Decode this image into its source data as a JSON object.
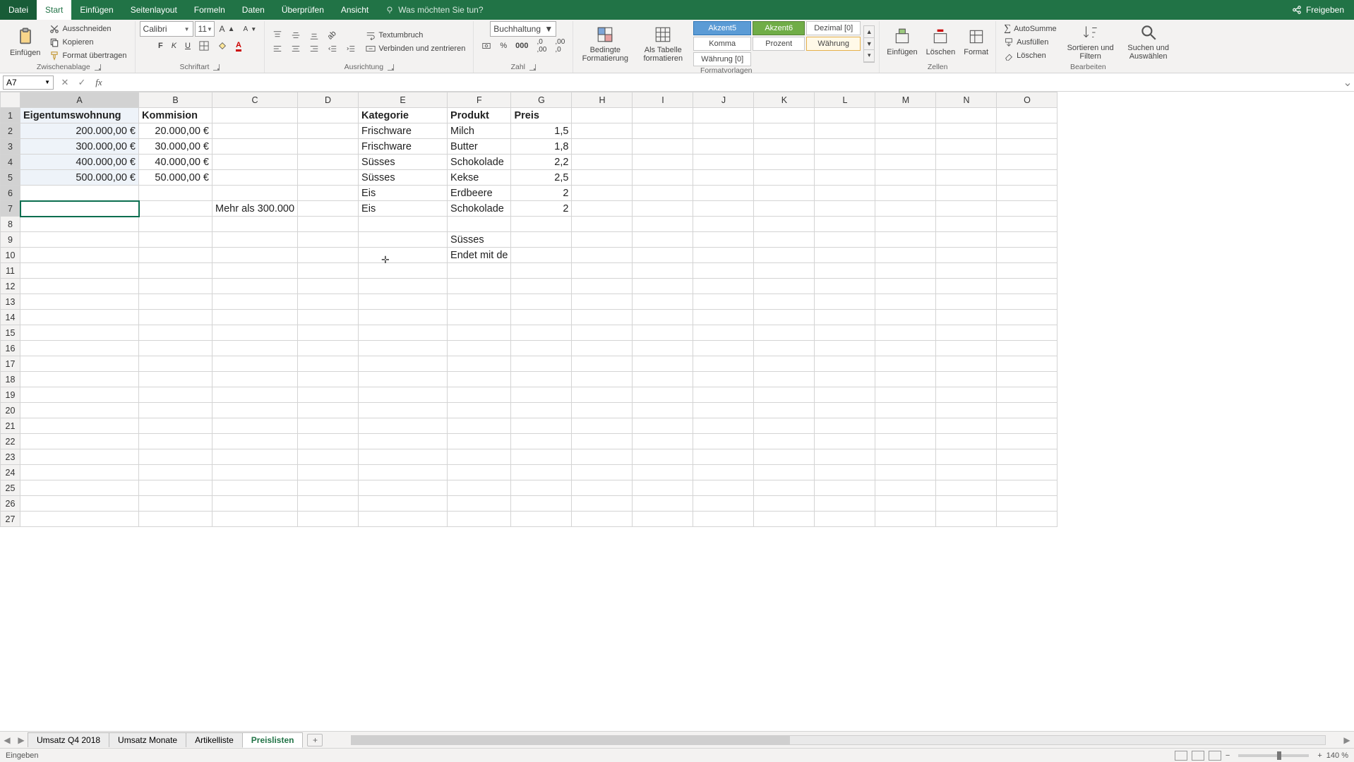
{
  "titlebar": {
    "file": "Datei",
    "tabs": [
      "Start",
      "Einfügen",
      "Seitenlayout",
      "Formeln",
      "Daten",
      "Überprüfen",
      "Ansicht"
    ],
    "active_tab": "Start",
    "tellme_placeholder": "Was möchten Sie tun?",
    "share": "Freigeben"
  },
  "ribbon": {
    "clipboard": {
      "paste": "Einfügen",
      "cut": "Ausschneiden",
      "copy": "Kopieren",
      "fmtpainter": "Format übertragen",
      "label": "Zwischenablage"
    },
    "font": {
      "name": "Calibri",
      "size": "11",
      "label": "Schriftart"
    },
    "align": {
      "wrap": "Textumbruch",
      "merge": "Verbinden und zentrieren",
      "label": "Ausrichtung"
    },
    "number": {
      "format": "Buchhaltung",
      "label": "Zahl"
    },
    "styles": {
      "cond": "Bedingte Formatierung",
      "astable": "Als Tabelle formatieren",
      "ak5": "Akzent5",
      "ak6": "Akzent6",
      "dezimal": "Dezimal [0]",
      "komma": "Komma",
      "prozent": "Prozent",
      "waehrung": "Währung",
      "waehrung0": "Währung [0]",
      "label": "Formatvorlagen"
    },
    "cells": {
      "insert": "Einfügen",
      "delete": "Löschen",
      "format": "Format",
      "label": "Zellen"
    },
    "editing": {
      "sum": "AutoSumme",
      "fill": "Ausfüllen",
      "clear": "Löschen",
      "sort": "Sortieren und Filtern",
      "find": "Suchen und Auswählen",
      "label": "Bearbeiten"
    }
  },
  "namebox": {
    "ref": "A7",
    "formula": ""
  },
  "columns": [
    "A",
    "B",
    "C",
    "D",
    "E",
    "F",
    "G",
    "H",
    "I",
    "J",
    "K",
    "L",
    "M",
    "N",
    "O"
  ],
  "cells": {
    "A1": "Eigentumswohnung",
    "B1": "Kommision",
    "E1": "Kategorie",
    "F1": "Produkt",
    "G1": "Preis",
    "A2": "200.000,00 €",
    "B2": "20.000,00 €",
    "E2": "Frischware",
    "F2": "Milch",
    "G2": "1,5",
    "A3": "300.000,00 €",
    "B3": "30.000,00 €",
    "E3": "Frischware",
    "F3": "Butter",
    "G3": "1,8",
    "A4": "400.000,00 €",
    "B4": "40.000,00 €",
    "E4": "Süsses",
    "F4": "Schokolade",
    "G4": "2,2",
    "A5": "500.000,00 €",
    "B5": "50.000,00 €",
    "E5": "Süsses",
    "F5": "Kekse",
    "G5": "2,5",
    "E6": "Eis",
    "F6": "Erdbeere",
    "G6": "2",
    "C7": "Mehr als 300.000",
    "E7": "Eis",
    "F7": "Schokolade",
    "G7": "2",
    "F9": "Süsses",
    "F10": "Endet mit de"
  },
  "sheet_tabs": {
    "tabs": [
      "Umsatz Q4 2018",
      "Umsatz Monate",
      "Artikelliste",
      "Preislisten"
    ],
    "active": "Preislisten"
  },
  "statusbar": {
    "mode": "Eingeben",
    "zoom": "140 %"
  }
}
